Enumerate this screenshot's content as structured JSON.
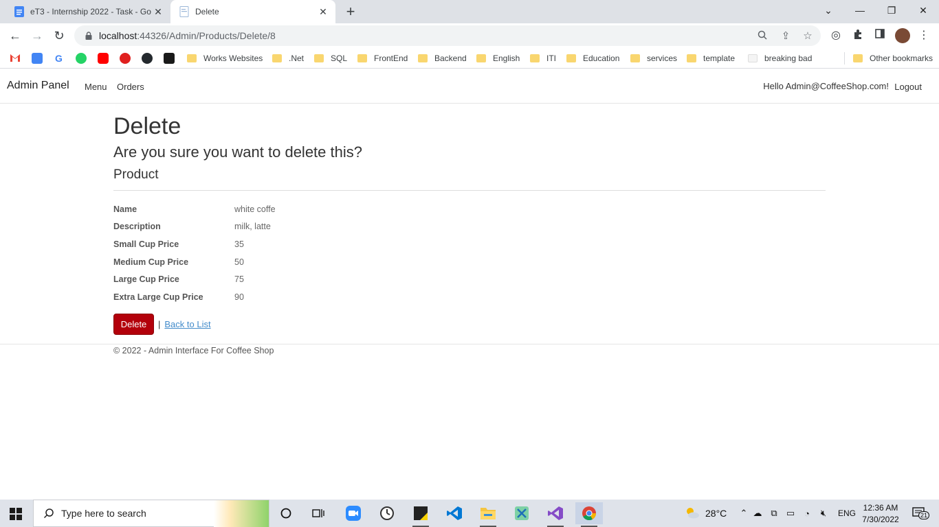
{
  "browser": {
    "tabs": [
      {
        "title": "eT3 - Internship 2022 - Task - Go",
        "active": false,
        "icon": "google-docs-icon"
      },
      {
        "title": "Delete",
        "active": true,
        "icon": "page-icon"
      }
    ],
    "url_host": "localhost",
    "url_path": ":44326/Admin/Products/Delete/8",
    "bookmarks": [
      "Works Websites",
      ".Net",
      "SQL",
      "FrontEnd",
      "Backend",
      "English",
      "ITI",
      "Education",
      "services",
      "template",
      "breaking bad"
    ],
    "other_bookmarks": "Other bookmarks"
  },
  "site": {
    "brand": "Admin Panel",
    "nav": [
      "Menu",
      "Orders"
    ],
    "greeting": "Hello Admin@CoffeeShop.com!",
    "logout": "Logout"
  },
  "page": {
    "title": "Delete",
    "confirm": "Are you sure you want to delete this?",
    "entity": "Product",
    "fields": [
      {
        "label": "Name",
        "value": "white coffe"
      },
      {
        "label": "Description",
        "value": "milk, latte"
      },
      {
        "label": "Small Cup Price",
        "value": "35"
      },
      {
        "label": "Medium Cup Price",
        "value": "50"
      },
      {
        "label": "Large Cup Price",
        "value": "75"
      },
      {
        "label": "Extra Large Cup Price",
        "value": "90"
      }
    ],
    "delete_label": "Delete",
    "separator": "|",
    "back_label": "Back to List",
    "footer": "© 2022 - Admin Interface For Coffee Shop"
  },
  "taskbar": {
    "search_placeholder": "Type here to search",
    "weather": "28°C",
    "language": "ENG",
    "time": "12:36 AM",
    "date": "7/30/2022",
    "notifications": "21"
  },
  "colors": {
    "danger": "#b3000b",
    "link": "#428bca",
    "tabstrip": "#dee1e6"
  }
}
